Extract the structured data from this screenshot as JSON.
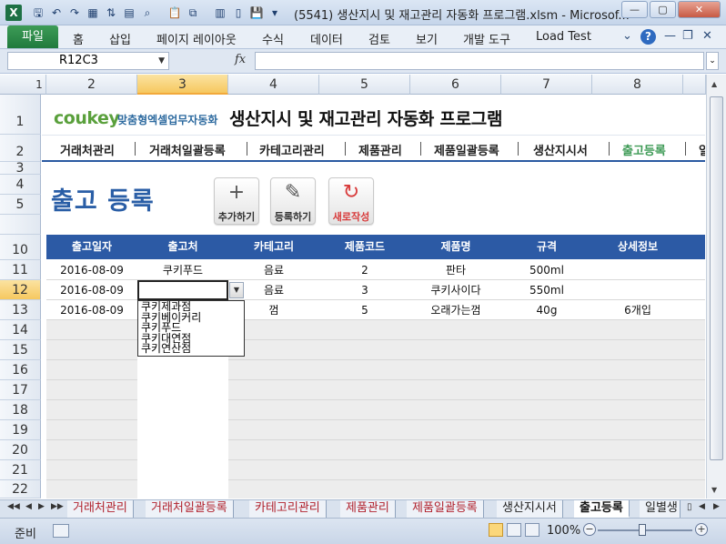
{
  "window": {
    "title": "(5541) 생산지시 및 재고관리 자동화 프로그램.xlsm  -  Microsof...",
    "app_icon": "X",
    "buttons": {
      "minimize": "—",
      "maximize": "▢",
      "close": "✕"
    }
  },
  "ribbon": {
    "file_tab": "파일",
    "tabs": [
      "홈",
      "삽입",
      "페이지 레이아웃",
      "수식",
      "데이터",
      "검토",
      "보기",
      "개발 도구",
      "Load Test"
    ],
    "help_icon": "?"
  },
  "formula_bar": {
    "name_box": "R12C3",
    "fx_label": "fx",
    "formula": ""
  },
  "columns": [
    "1",
    "2",
    "3",
    "4",
    "5",
    "6",
    "7",
    "8"
  ],
  "rows": [
    "1",
    "2",
    "3",
    "4",
    "5",
    "10",
    "11",
    "12",
    "13",
    "14",
    "15",
    "16",
    "17",
    "18",
    "19",
    "20",
    "21",
    "22"
  ],
  "header": {
    "logo": "coukey",
    "logo_sub": "맞춤형엑셀업무자동화",
    "program_title": "생산지시 및 재고관리 자동화 프로그램"
  },
  "nav": {
    "items": [
      "거래처관리",
      "거래처일괄등록",
      "카테고리관리",
      "제품관리",
      "제품일괄등록",
      "생산지시서",
      "출고등록",
      "일"
    ],
    "active": "출고등록"
  },
  "page": {
    "title": "출고 등록",
    "buttons": [
      {
        "icon": "+",
        "label": "추가하기"
      },
      {
        "icon": "✎",
        "label": "등록하기"
      },
      {
        "icon": "↻",
        "label": "새로작성"
      }
    ]
  },
  "table": {
    "headers": [
      "출고일자",
      "출고처",
      "카테고리",
      "제품코드",
      "제품명",
      "규격",
      "상세정보"
    ],
    "rows": [
      [
        "2016-08-09",
        "쿠키푸드",
        "음료",
        "2",
        "판타",
        "500ml",
        ""
      ],
      [
        "2016-08-09",
        "",
        "음료",
        "3",
        "쿠키사이다",
        "550ml",
        ""
      ],
      [
        "2016-08-09",
        "",
        "껌",
        "5",
        "오래가는껌",
        "40g",
        "6개입"
      ]
    ]
  },
  "dropdown": {
    "options": [
      "쿠키제과점",
      "쿠키베이커리",
      "쿠키푸드",
      "쿠키대연점",
      "쿠키연산점"
    ]
  },
  "sheet_tabs": {
    "tabs": [
      "거래처관리",
      "거래처일괄등록",
      "카테고리관리",
      "제품관리",
      "제품일괄등록",
      "생산지시서",
      "출고등록",
      "일별생"
    ],
    "active": "출고등록"
  },
  "status": {
    "ready": "준비",
    "zoom": "100%"
  },
  "colors": {
    "accent_blue": "#2c5aa5",
    "nav_active": "#3d9a55",
    "title_blue": "#2a5ea6",
    "new_button": "#d83a3a"
  }
}
